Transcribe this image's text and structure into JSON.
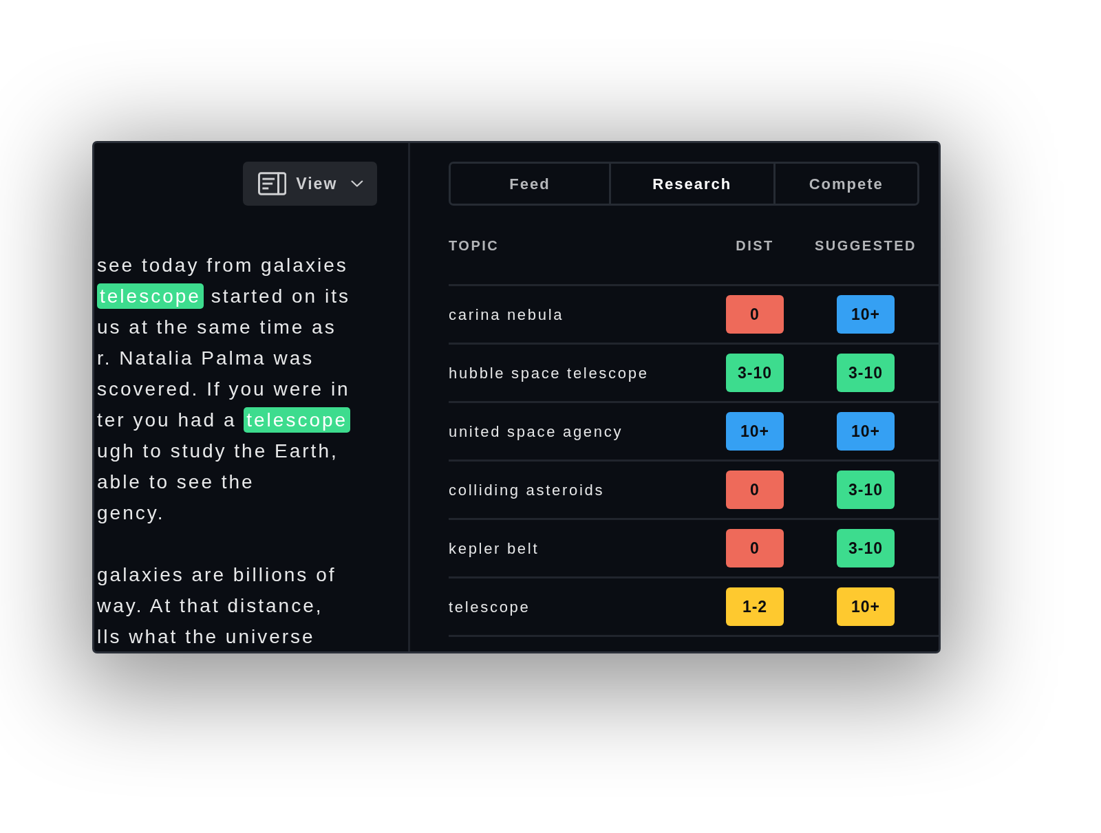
{
  "view_button": {
    "label": "View"
  },
  "article": {
    "paragraphs": [
      {
        "lines": [
          {
            "segments": [
              {
                "text": "see today from galaxies",
                "highlighted": false
              }
            ]
          },
          {
            "segments": [
              {
                "text": "telescope",
                "highlighted": true
              },
              {
                "text": "started on its",
                "highlighted": false
              }
            ]
          },
          {
            "segments": [
              {
                "text": "us at the same time as",
                "highlighted": false
              }
            ]
          },
          {
            "segments": [
              {
                "text": "r. Natalia Palma was",
                "highlighted": false
              }
            ]
          },
          {
            "segments": [
              {
                "text": "scovered. If you were in",
                "highlighted": false
              }
            ]
          },
          {
            "segments": [
              {
                "text": "ter you had a",
                "highlighted": false
              },
              {
                "text": "telescope",
                "highlighted": true
              }
            ]
          },
          {
            "segments": [
              {
                "text": "ugh to study the Earth,",
                "highlighted": false
              }
            ]
          },
          {
            "segments": [
              {
                "text": "able to see the",
                "highlighted": false
              }
            ]
          },
          {
            "segments": [
              {
                "text": "gency.",
                "highlighted": false
              }
            ]
          }
        ]
      },
      {
        "lines": [
          {
            "segments": [
              {
                "text": "galaxies are billions of",
                "highlighted": false
              }
            ]
          },
          {
            "segments": [
              {
                "text": "way. At that distance,",
                "highlighted": false
              }
            ]
          },
          {
            "segments": [
              {
                "text": "lls what the universe",
                "highlighted": false
              }
            ]
          }
        ]
      }
    ]
  },
  "tabs": [
    {
      "label": "Feed",
      "selected": false
    },
    {
      "label": "Research",
      "selected": true
    },
    {
      "label": "Compete",
      "selected": false
    }
  ],
  "table": {
    "columns": [
      "TOPIC",
      "DIST",
      "SUGGESTED"
    ],
    "rows": [
      {
        "topic": "carina nebula",
        "dist": {
          "label": "0",
          "color": "#ee6a5a"
        },
        "suggested": {
          "label": "10+",
          "color": "#35a0f3"
        }
      },
      {
        "topic": "hubble space telescope",
        "dist": {
          "label": "3-10",
          "color": "#3ddc8e"
        },
        "suggested": {
          "label": "3-10",
          "color": "#3ddc8e"
        }
      },
      {
        "topic": "united space agency",
        "dist": {
          "label": "10+",
          "color": "#35a0f3"
        },
        "suggested": {
          "label": "10+",
          "color": "#35a0f3"
        }
      },
      {
        "topic": "colliding asteroids",
        "dist": {
          "label": "0",
          "color": "#ee6a5a"
        },
        "suggested": {
          "label": "3-10",
          "color": "#3ddc8e"
        }
      },
      {
        "topic": "kepler belt",
        "dist": {
          "label": "0",
          "color": "#ee6a5a"
        },
        "suggested": {
          "label": "3-10",
          "color": "#3ddc8e"
        }
      },
      {
        "topic": "telescope",
        "dist": {
          "label": "1-2",
          "color": "#fec92f"
        },
        "suggested": {
          "label": "10+",
          "color": "#fec92f"
        }
      }
    ]
  }
}
